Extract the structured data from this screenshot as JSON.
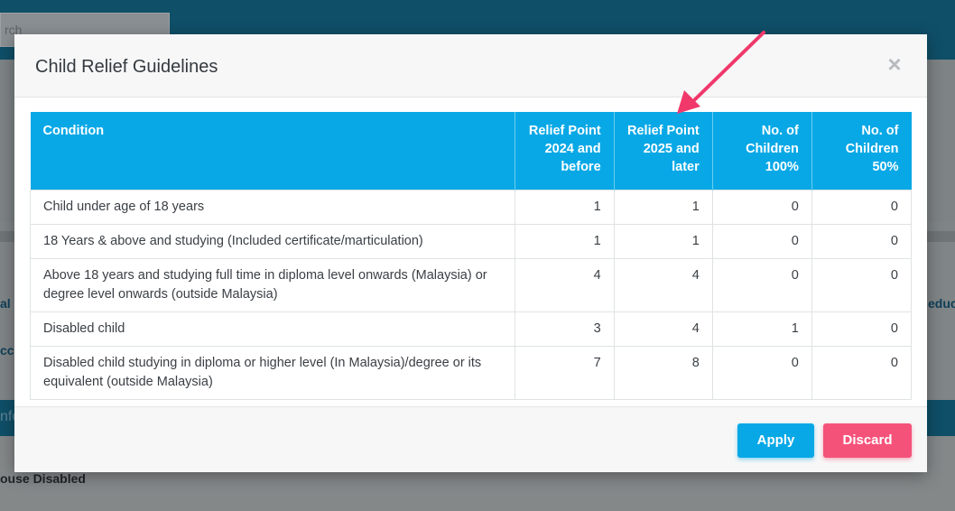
{
  "background": {
    "search_placeholder": "rch",
    "left_text_1": "al I",
    "left_text_2": "cc",
    "right_text": "educ",
    "bar_text": "nfo",
    "bottom_text": "ouse Disabled"
  },
  "modal": {
    "title": "Child Relief Guidelines",
    "close_label": "×",
    "columns": [
      "Condition",
      "Relief Point 2024 and before",
      "Relief Point 2025 and later",
      "No. of Children 100%",
      "No. of Children 50%"
    ],
    "rows": [
      {
        "condition": "Child under age of 18 years",
        "rp2024": "1",
        "rp2025": "1",
        "c100": "0",
        "c50": "0"
      },
      {
        "condition": "18 Years & above and studying (Included certificate/marticulation)",
        "rp2024": "1",
        "rp2025": "1",
        "c100": "0",
        "c50": "0"
      },
      {
        "condition": "Above 18 years and studying full time in diploma level onwards (Malaysia) or degree level onwards (outside Malaysia)",
        "rp2024": "4",
        "rp2025": "4",
        "c100": "0",
        "c50": "0"
      },
      {
        "condition": "Disabled child",
        "rp2024": "3",
        "rp2025": "4",
        "c100": "1",
        "c50": "0"
      },
      {
        "condition": "Disabled child studying in diploma or higher level (In Malaysia)/degree or its equivalent (outside Malaysia)",
        "rp2024": "7",
        "rp2025": "8",
        "c100": "0",
        "c50": "0"
      }
    ],
    "apply_label": "Apply",
    "discard_label": "Discard"
  },
  "colors": {
    "header_blue": "#08a8e6",
    "discard_pink": "#f5527a",
    "arrow_pink": "#f0386b"
  }
}
